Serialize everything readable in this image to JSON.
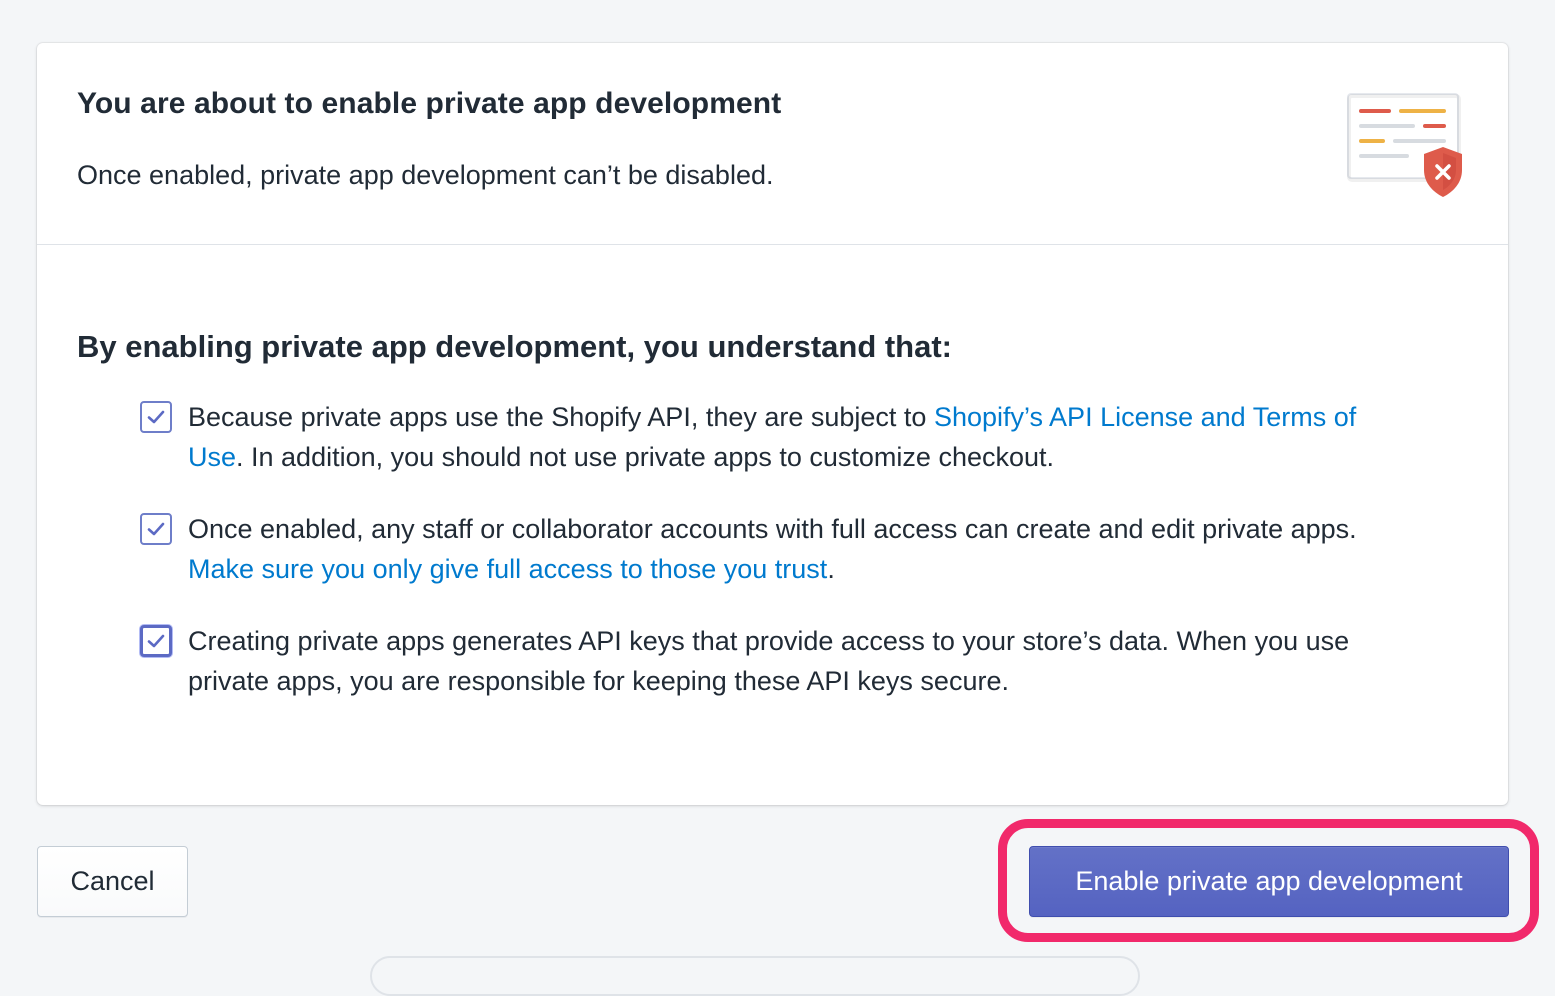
{
  "header": {
    "title": "You are about to enable private app development",
    "subtitle": "Once enabled, private app development can’t be disabled.",
    "illustration": "document-shield-warning-icon"
  },
  "body": {
    "heading": "By enabling private app development, you understand that:",
    "items": [
      {
        "checked": true,
        "text_before": "Because private apps use the Shopify API, they are subject to ",
        "link": "Shopify’s API License and Terms of Use",
        "text_after": ". In addition, you should not use private apps to customize checkout."
      },
      {
        "checked": true,
        "text_before": "Once enabled, any staff or collaborator accounts with full access can create and edit private apps. ",
        "link": "Make sure you only give full access to those you trust",
        "text_after": "."
      },
      {
        "checked": true,
        "focused": true,
        "text_before": "Creating private apps generates API keys that provide access to your store’s data. When you use private apps, you are responsible for keeping these API keys secure.",
        "link": "",
        "text_after": ""
      }
    ]
  },
  "actions": {
    "cancel_label": "Cancel",
    "primary_label": "Enable private app development"
  },
  "colors": {
    "accent": "#5c6ac4",
    "link": "#007ace",
    "highlight": "#f1296b",
    "background": "#f4f6f8"
  }
}
